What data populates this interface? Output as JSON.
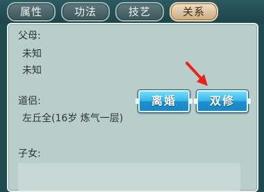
{
  "tabs": [
    {
      "label": "属性",
      "active": false
    },
    {
      "label": "功法",
      "active": false
    },
    {
      "label": "技艺",
      "active": false
    },
    {
      "label": "关系",
      "active": true
    }
  ],
  "parents": {
    "label": "父母:",
    "father": "未知",
    "mother": "未知"
  },
  "partner": {
    "label": "道侣:",
    "detail": "左丘全(16岁 炼气一层)",
    "divorce_button": "离婚",
    "dual_cultivate_button": "双修"
  },
  "children": {
    "label": "子女:"
  },
  "colors": {
    "accent_button": "#38b6ea",
    "active_tab": "#e9d6b5",
    "hint_arrow": "#e8231e"
  }
}
